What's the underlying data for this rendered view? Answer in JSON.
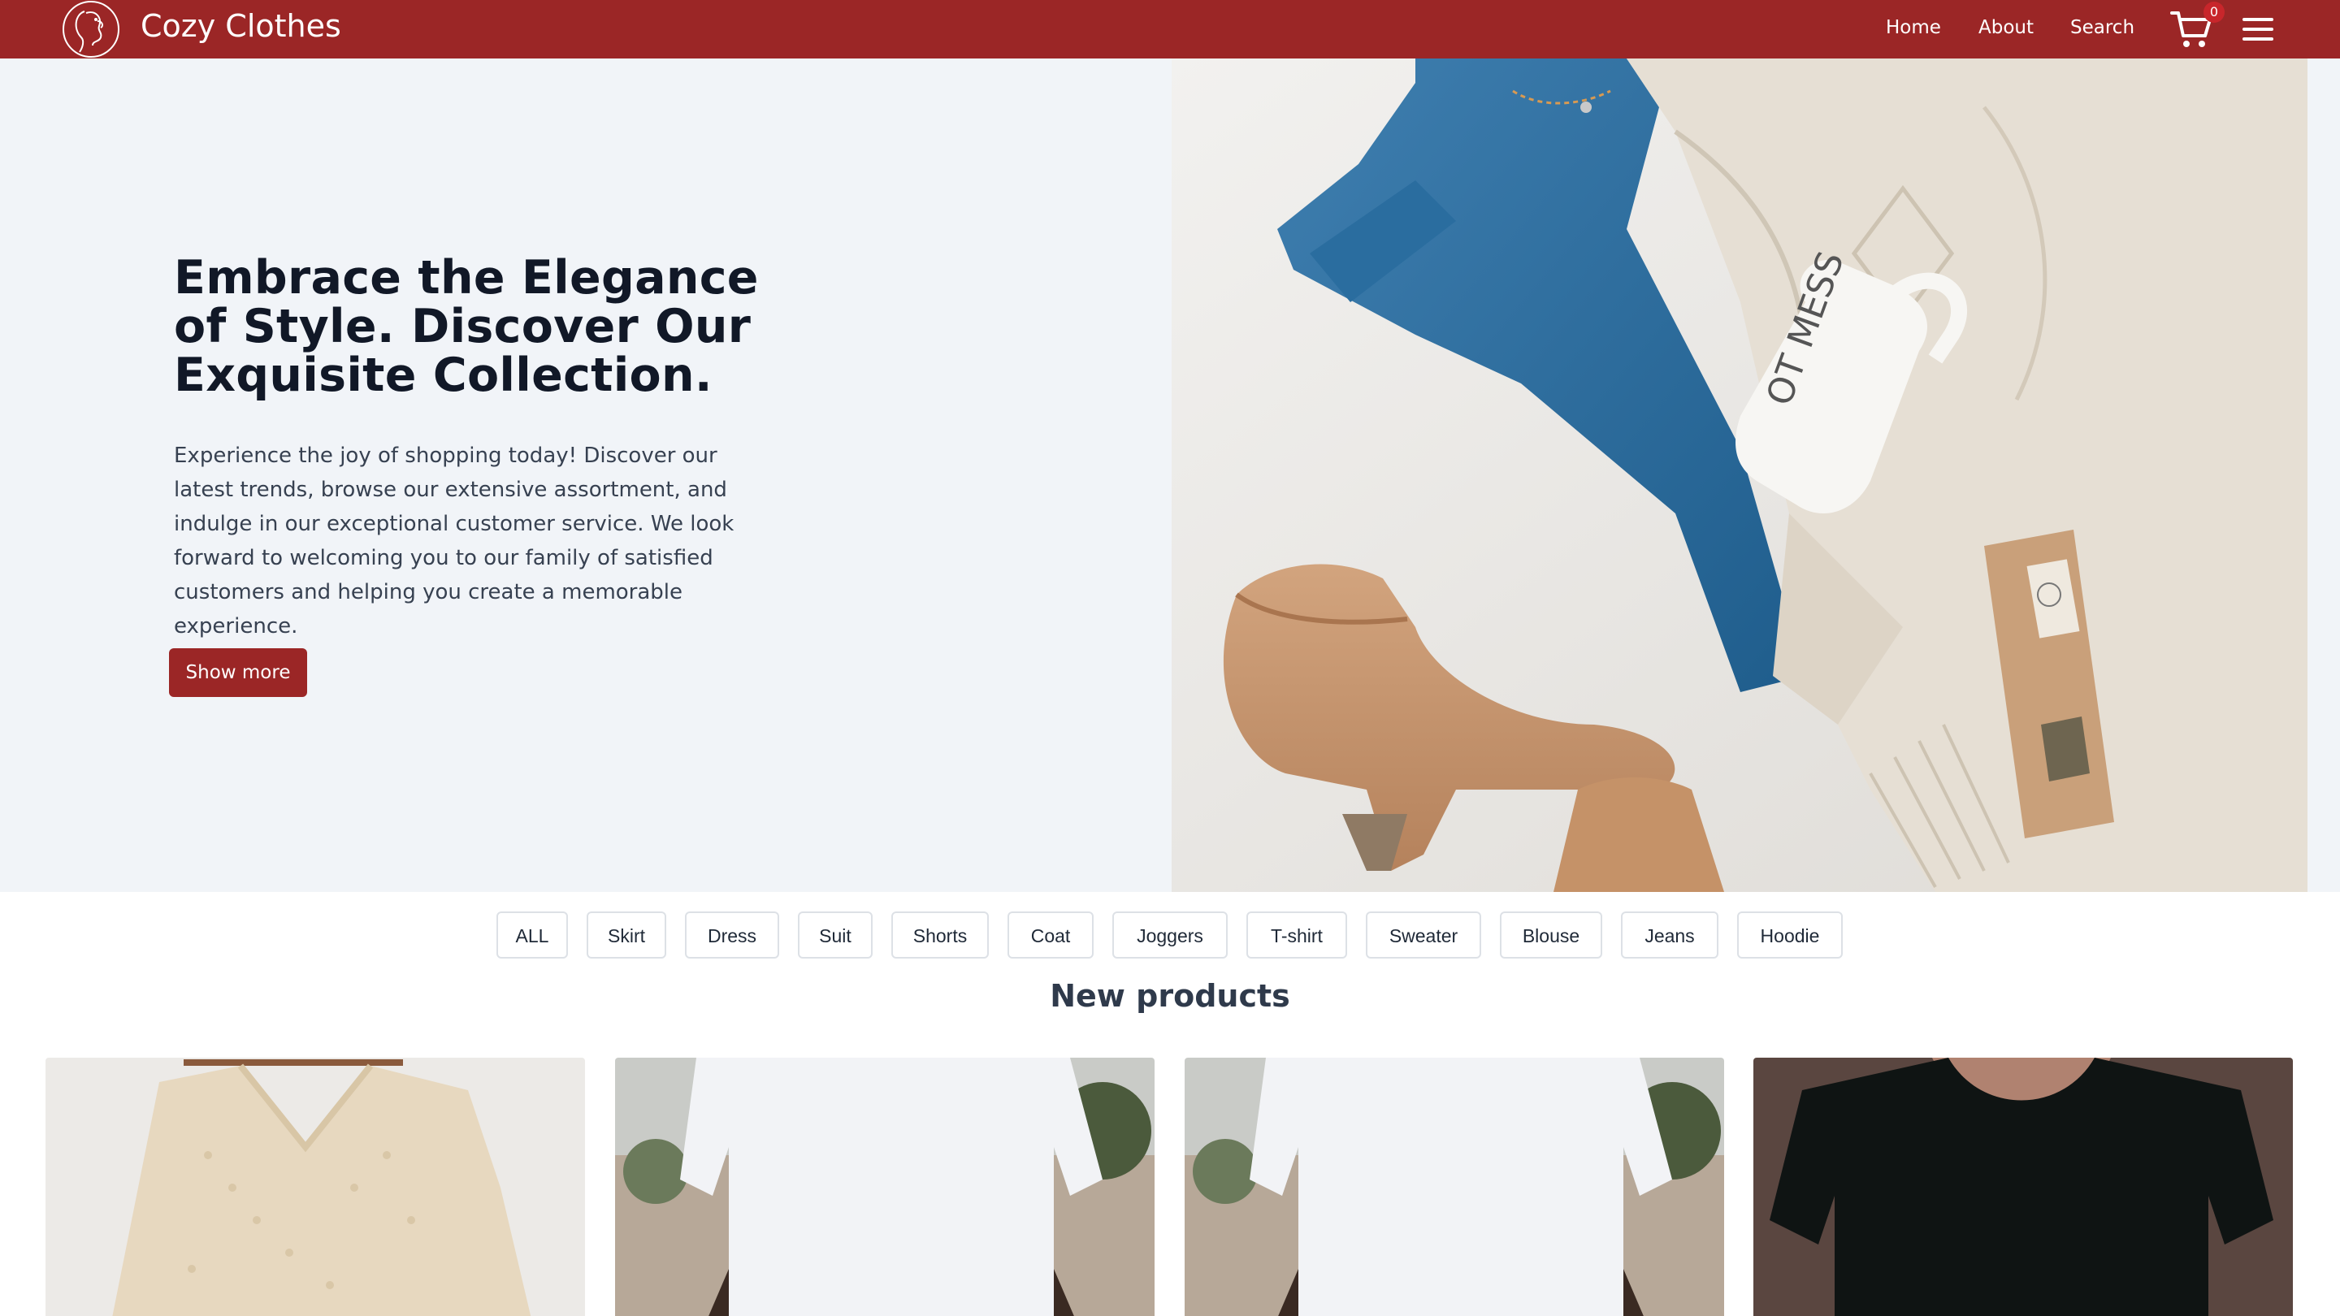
{
  "header": {
    "brand": "Cozy Clothes",
    "nav": [
      "Home",
      "About",
      "Search"
    ],
    "cart_count": "0",
    "color": "#9b2626"
  },
  "hero": {
    "title": "Embrace the Elegance of Style. Discover Our Exquisite Collection.",
    "text": "Experience the joy of shopping today! Discover our latest trends, browse our extensive assortment, and indulge in our exceptional customer service. We look forward to welcoming you to our family of satisfied customers and helping you create a memorable experience.",
    "button": "Show more"
  },
  "categories": [
    "ALL",
    "Skirt",
    "Dress",
    "Suit",
    "Shorts",
    "Coat",
    "Joggers",
    "T-shirt",
    "Sweater",
    "Blouse",
    "Jeans",
    "Hoodie"
  ],
  "section_title": "New products",
  "icons": [
    "logo-icon",
    "cart-icon",
    "menu-icon"
  ]
}
